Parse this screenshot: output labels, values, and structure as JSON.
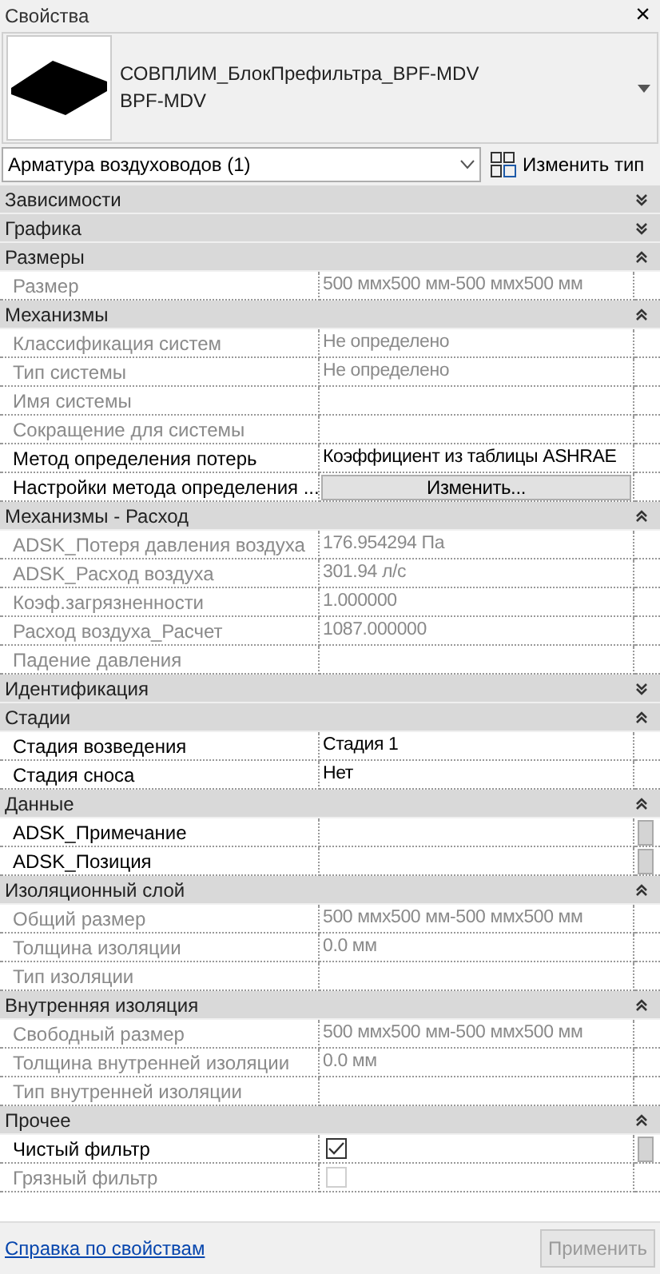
{
  "window": {
    "title": "Свойства",
    "close": "×"
  },
  "type_selector": {
    "family": "СОВПЛИМ_БлокПрефильтра_BPF-MDV",
    "type": "BPF-MDV"
  },
  "category_filter": {
    "value": "Арматура воздуховодов (1)"
  },
  "edit_type_button": {
    "label": "Изменить тип"
  },
  "sections": [
    {
      "title": "Зависимости",
      "expanded": false
    },
    {
      "title": "Графика",
      "expanded": false
    },
    {
      "title": "Размеры",
      "expanded": true,
      "rows": [
        {
          "kind": "text",
          "label": "Размер",
          "value": "500 ммx500 мм-500 ммx500 мм",
          "editable": false,
          "side_button": false
        }
      ]
    },
    {
      "title": "Механизмы",
      "expanded": true,
      "rows": [
        {
          "kind": "text",
          "label": "Классификация систем",
          "value": "Не определено",
          "editable": false,
          "side_button": false
        },
        {
          "kind": "text",
          "label": "Тип системы",
          "value": "Не определено",
          "editable": false,
          "side_button": false
        },
        {
          "kind": "text",
          "label": "Имя системы",
          "editable": false,
          "side_button": false
        },
        {
          "kind": "text",
          "label": "Сокращение для системы",
          "editable": false,
          "side_button": false
        },
        {
          "kind": "text",
          "label": "Метод определения потерь",
          "value": "Коэффициент из таблицы ASHRAE",
          "editable": true,
          "side_button": false
        },
        {
          "kind": "button",
          "label": "Настройки метода определения ...",
          "value": "Изменить...",
          "editable": true,
          "side_button": false
        }
      ]
    },
    {
      "title": "Механизмы - Расход",
      "expanded": true,
      "rows": [
        {
          "kind": "text",
          "label": "ADSK_Потеря давления воздуха",
          "value": "176.954294 Па",
          "editable": false,
          "side_button": false
        },
        {
          "kind": "text",
          "label": "ADSK_Расход воздуха",
          "value": "301.94 л/с",
          "editable": false,
          "side_button": false
        },
        {
          "kind": "text",
          "label": "Коэф.загрязненности",
          "value": "1.000000",
          "editable": false,
          "side_button": false
        },
        {
          "kind": "text",
          "label": "Расход воздуха_Расчет",
          "value": "1087.000000",
          "editable": false,
          "side_button": false
        },
        {
          "kind": "text",
          "label": "Падение давления",
          "editable": false,
          "side_button": false
        }
      ]
    },
    {
      "title": "Идентификация",
      "expanded": false
    },
    {
      "title": "Стадии",
      "expanded": true,
      "rows": [
        {
          "kind": "text",
          "label": "Стадия возведения",
          "value": "Стадия 1",
          "editable": true,
          "side_button": false
        },
        {
          "kind": "text",
          "label": "Стадия сноса",
          "value": "Нет",
          "editable": true,
          "side_button": false
        }
      ]
    },
    {
      "title": "Данные",
      "expanded": true,
      "rows": [
        {
          "kind": "text",
          "label": "ADSK_Примечание",
          "editable": true,
          "side_button": true
        },
        {
          "kind": "text",
          "label": "ADSK_Позиция",
          "editable": true,
          "side_button": true
        }
      ]
    },
    {
      "title": "Изоляционный слой",
      "expanded": true,
      "rows": [
        {
          "kind": "text",
          "label": "Общий размер",
          "value": "500 ммx500 мм-500 ммx500 мм",
          "editable": false,
          "side_button": false
        },
        {
          "kind": "text",
          "label": "Толщина изоляции",
          "value": "0.0 мм",
          "editable": false,
          "side_button": false
        },
        {
          "kind": "text",
          "label": "Тип изоляции",
          "editable": false,
          "side_button": false
        }
      ]
    },
    {
      "title": "Внутренняя изоляция",
      "expanded": true,
      "rows": [
        {
          "kind": "text",
          "label": "Свободный размер",
          "value": "500 ммx500 мм-500 ммx500 мм",
          "editable": false,
          "side_button": false
        },
        {
          "kind": "text",
          "label": "Толщина внутренней изоляции",
          "value": "0.0 мм",
          "editable": false,
          "side_button": false
        },
        {
          "kind": "text",
          "label": "Тип внутренней изоляции",
          "editable": false,
          "side_button": false
        }
      ]
    },
    {
      "title": "Прочее",
      "expanded": true,
      "rows": [
        {
          "kind": "checkbox",
          "label": "Чистый фильтр",
          "checked": true,
          "editable": true,
          "side_button": true
        },
        {
          "kind": "checkbox",
          "label": "Грязный фильтр",
          "checked": false,
          "editable": false,
          "side_button": false
        }
      ]
    }
  ],
  "footer": {
    "help_link": "Справка по свойствам",
    "apply_button": {
      "label": "Применить",
      "disabled": true
    }
  }
}
